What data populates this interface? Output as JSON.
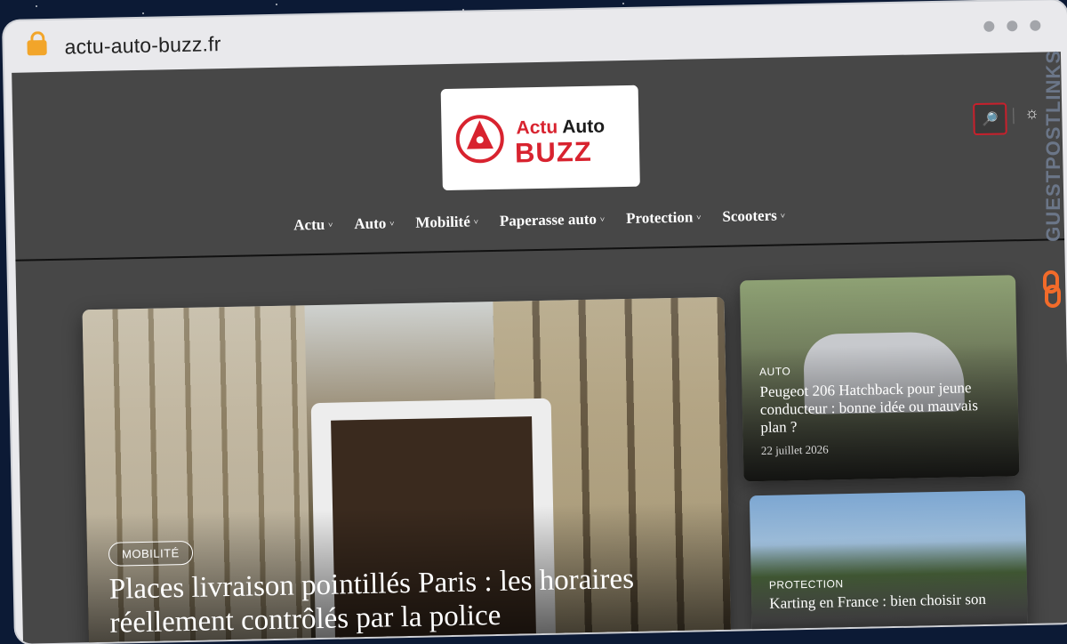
{
  "browser": {
    "url": "actu-auto-buzz.fr",
    "lock_icon": "lock-icon"
  },
  "logo": {
    "line1_a": "Actu",
    "line1_b": "Auto",
    "line2": "BUZZ"
  },
  "header": {
    "search_icon": "search-icon",
    "theme_icon": "sun-icon",
    "theme_glyph": "☼",
    "search_glyph": "🔎"
  },
  "nav": {
    "items": [
      {
        "label": "Actu"
      },
      {
        "label": "Auto"
      },
      {
        "label": "Mobilité"
      },
      {
        "label": "Paperasse auto"
      },
      {
        "label": "Protection"
      },
      {
        "label": "Scooters"
      }
    ],
    "chevron": "˅"
  },
  "featured": {
    "category": "MOBILITÉ",
    "title": "Places livraison pointillés Paris : les horaires réellement contrôlés par la police"
  },
  "side_articles": [
    {
      "category": "AUTO",
      "title": "Peugeot 206 Hatchback pour jeune conducteur : bonne idée ou mauvais plan ?",
      "date": "22 juillet 2026"
    },
    {
      "category": "PROTECTION",
      "title": "Karting en France : bien choisir son"
    }
  ],
  "watermark": {
    "text": "GUESTPOSTLINKS"
  },
  "colors": {
    "brand_red": "#d8232f",
    "page_bg": "#474747",
    "watermark_orange": "#f26b2a"
  }
}
